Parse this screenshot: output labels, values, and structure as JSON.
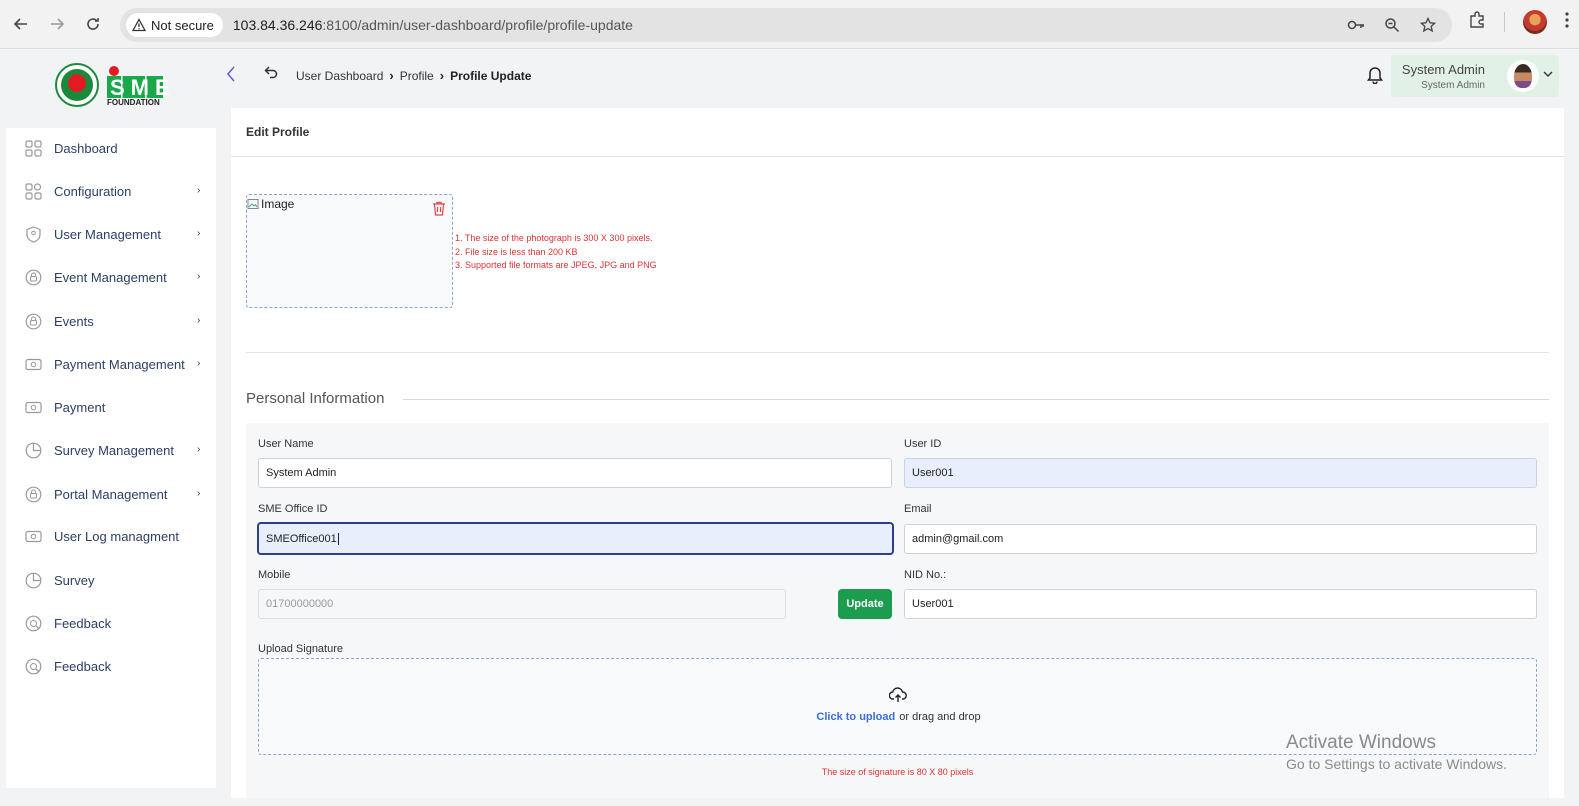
{
  "browser": {
    "security_label": "Not secure",
    "url_host": "103.84.36.246",
    "url_path": ":8100/admin/user-dashboard/profile/profile-update"
  },
  "header": {
    "breadcrumb": [
      "User Dashboard",
      "Profile",
      "Profile Update"
    ],
    "user_name": "System Admin",
    "user_role": "System Admin"
  },
  "logo": {
    "text": "SME",
    "subtext": "FOUNDATION"
  },
  "sidebar": {
    "items": [
      {
        "label": "Dashboard",
        "icon": "grid-icon",
        "has_children": false
      },
      {
        "label": "Configuration",
        "icon": "config-icon",
        "has_children": true
      },
      {
        "label": "User Management",
        "icon": "shield-icon",
        "has_children": true
      },
      {
        "label": "Event Management",
        "icon": "lock-icon",
        "has_children": true
      },
      {
        "label": "Events",
        "icon": "lock-icon",
        "has_children": true
      },
      {
        "label": "Payment Management",
        "icon": "cash-icon",
        "has_children": true
      },
      {
        "label": "Payment",
        "icon": "cash-icon",
        "has_children": false
      },
      {
        "label": "Survey Management",
        "icon": "pie-icon",
        "has_children": true
      },
      {
        "label": "Portal Management",
        "icon": "lock-icon",
        "has_children": true
      },
      {
        "label": "User Log managment",
        "icon": "cash-icon",
        "has_children": false
      },
      {
        "label": "Survey",
        "icon": "pie-icon",
        "has_children": false
      },
      {
        "label": "Feedback",
        "icon": "feedback-icon",
        "has_children": false
      },
      {
        "label": "Feedback",
        "icon": "feedback-icon",
        "has_children": false
      }
    ]
  },
  "card": {
    "title": "Edit Profile",
    "image_alt": "Image",
    "photo_rules": [
      "1. The size of the photograph is 300 X 300 pixels.",
      "2. File size is less than 200 KB",
      "3. Supported file formats are JPEG, JPG and PNG"
    ],
    "section_title": "Personal Information"
  },
  "form": {
    "user_name_label": "User Name",
    "user_name_value": "System Admin",
    "user_id_label": "User ID",
    "user_id_value": "User001",
    "office_label": "SME Office ID",
    "office_value": "SMEOffice001",
    "email_label": "Email",
    "email_value": "admin@gmail.com",
    "mobile_label": "Mobile",
    "mobile_placeholder": "01700000000",
    "update_label": "Update",
    "nid_label": "NID No.:",
    "nid_value": "User001",
    "signature_label": "Upload Signature",
    "upload_link": "Click to upload",
    "upload_rest": "or drag and drop",
    "signature_note": "The size of signature is 80 X 80 pixels"
  },
  "watermark": {
    "line1": "Activate Windows",
    "line2": "Go to Settings to activate Windows."
  },
  "colors": {
    "accent_green": "#1c9c4e",
    "link_blue": "#3a6fd8",
    "warning_red": "#dd3333",
    "sidebar_text": "#2c3e66"
  }
}
